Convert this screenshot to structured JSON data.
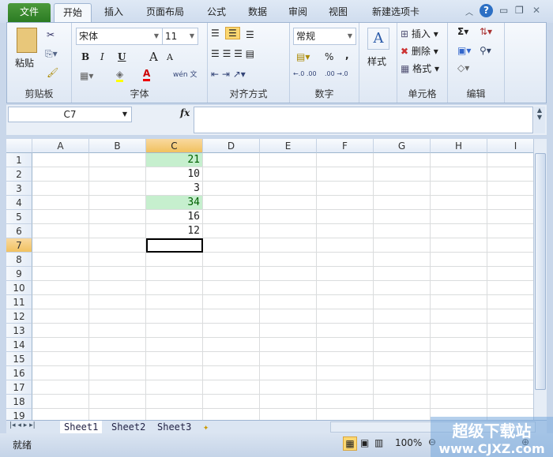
{
  "tabs": [
    "文件",
    "开始",
    "插入",
    "页面布局",
    "公式",
    "数据",
    "审阅",
    "视图",
    "新建选项卡"
  ],
  "window_controls": {
    "minimize_ribbon": "︿",
    "help": "?",
    "minimize": "▭",
    "restore": "❐",
    "close": "✕"
  },
  "ribbon": {
    "clipboard": {
      "label": "剪贴板",
      "paste": "粘贴"
    },
    "font": {
      "label": "字体",
      "font_name": "宋体",
      "font_size": "11",
      "bold": "B",
      "italic": "I",
      "underline": "U",
      "grow": "A",
      "shrink": "A",
      "font_color": "A",
      "phonetic": "wén 文"
    },
    "alignment": {
      "label": "对齐方式"
    },
    "number": {
      "label": "数字",
      "format": "常规",
      "percent": "%",
      "comma": ",",
      "inc_decimal": "←.0 .00",
      "dec_decimal": ".00 →.0"
    },
    "styles": {
      "label": "样式"
    },
    "cells": {
      "label": "单元格",
      "insert": "插入",
      "delete": "删除",
      "format": "格式"
    },
    "editing": {
      "label": "编辑",
      "sum": "Σ"
    }
  },
  "formula_bar": {
    "name_box": "C7",
    "fx": "fx",
    "value": ""
  },
  "columns": [
    "A",
    "B",
    "C",
    "D",
    "E",
    "F",
    "G",
    "H",
    "I"
  ],
  "rows": [
    "1",
    "2",
    "3",
    "4",
    "5",
    "6",
    "7",
    "8",
    "9",
    "10",
    "11",
    "12",
    "13",
    "14",
    "15",
    "16",
    "17",
    "18",
    "19"
  ],
  "cells_c": [
    "21",
    "10",
    "3",
    "34",
    "16",
    "12"
  ],
  "highlight": {
    "fill": "#c6efce",
    "text": "#006100",
    "rows": [
      1,
      4
    ]
  },
  "selected_cell": "C7",
  "sheets": [
    "Sheet1",
    "Sheet2",
    "Sheet3"
  ],
  "status": {
    "ready": "就绪",
    "zoom": "100%"
  },
  "watermark": {
    "line1": "超级下载站",
    "line2": "www.CJXZ.com"
  }
}
